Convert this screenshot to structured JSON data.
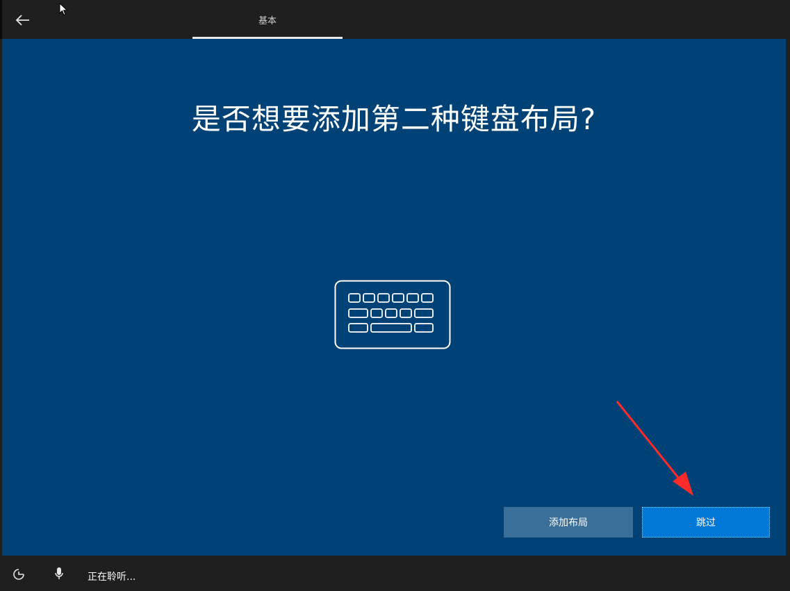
{
  "header": {
    "back_icon": "back-arrow-icon",
    "tab_label": "基本"
  },
  "main": {
    "title": "是否想要添加第二种键盘布局?",
    "illustration_icon": "keyboard-icon",
    "background_color": "#004275"
  },
  "actions": {
    "add_layout_label": "添加布局",
    "skip_label": "跳过",
    "skip_color": "#0078d7",
    "add_layout_color": "#3a6f99"
  },
  "footer": {
    "ease_of_access_icon": "ease-of-access-icon",
    "mic_icon": "microphone-icon",
    "status_text": "正在聆听..."
  },
  "annotation": {
    "arrow_color": "#ff2a2a"
  }
}
